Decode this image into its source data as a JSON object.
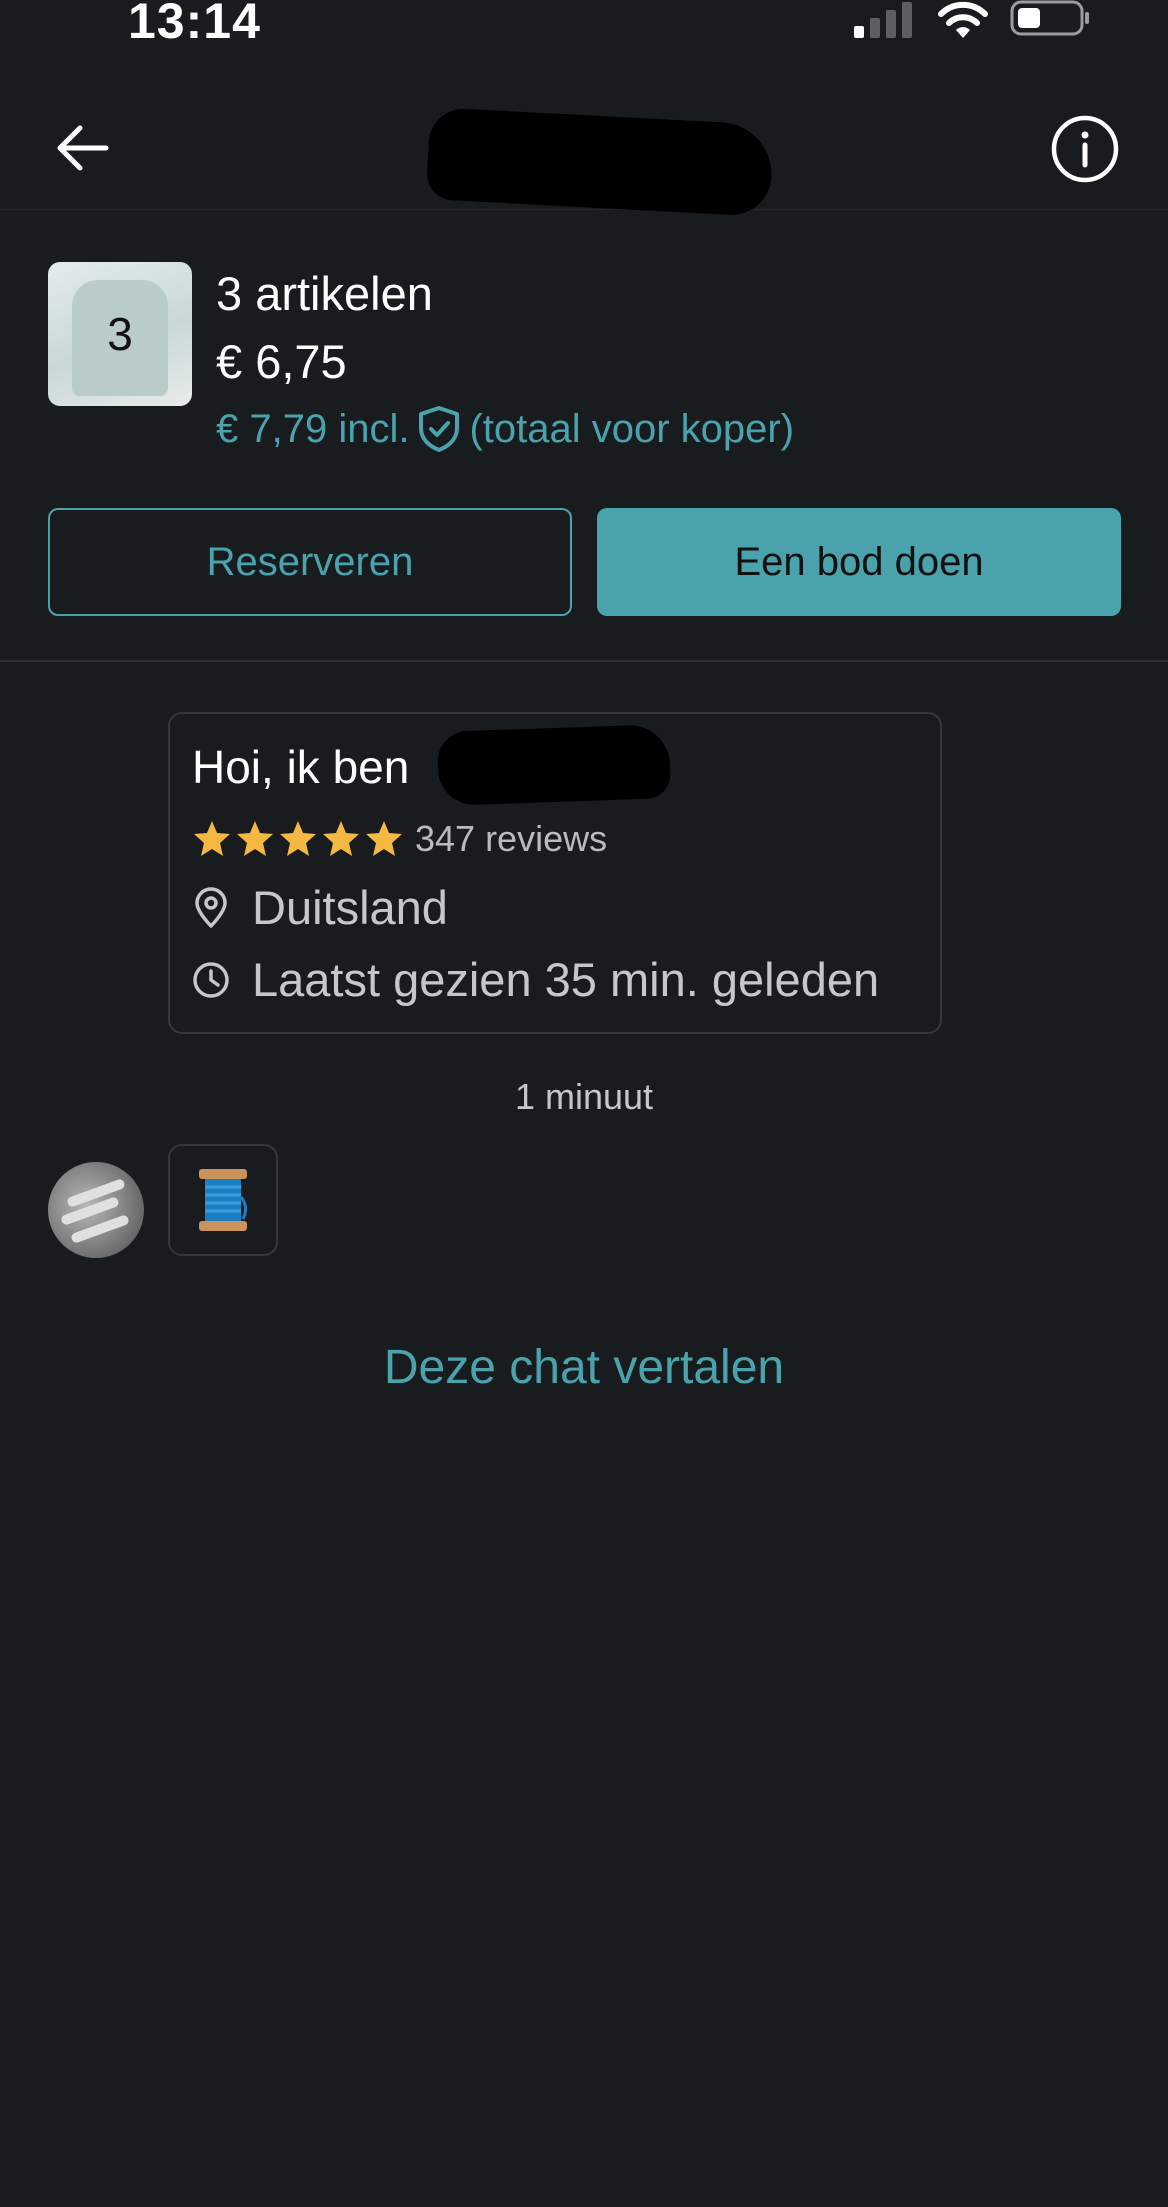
{
  "status_bar": {
    "time": "13:14"
  },
  "item": {
    "thumb_count": "3",
    "count_label": "3 artikelen",
    "price": "€ 6,75",
    "incl_price": "€ 7,79 incl.",
    "incl_suffix": "(totaal voor koper)"
  },
  "actions": {
    "reserve_label": "Reserveren",
    "offer_label": "Een bod doen"
  },
  "seller": {
    "greeting": "Hoi, ik ben",
    "rating_stars": 5,
    "reviews": "347 reviews",
    "location": "Duitsland",
    "last_seen": "Laatst gezien 35 min. geleden"
  },
  "chat": {
    "timestamp": "1 minuut",
    "translate_label": "Deze chat vertalen"
  },
  "colors": {
    "background": "#191c1f",
    "accent": "#4aa3ac",
    "star": "#f5b840"
  },
  "icons": {
    "back": "arrow-left-icon",
    "info": "info-circle-icon",
    "shield": "shield-check-icon",
    "location": "location-pin-icon",
    "clock": "clock-icon",
    "sticker": "thread-spool-icon"
  }
}
